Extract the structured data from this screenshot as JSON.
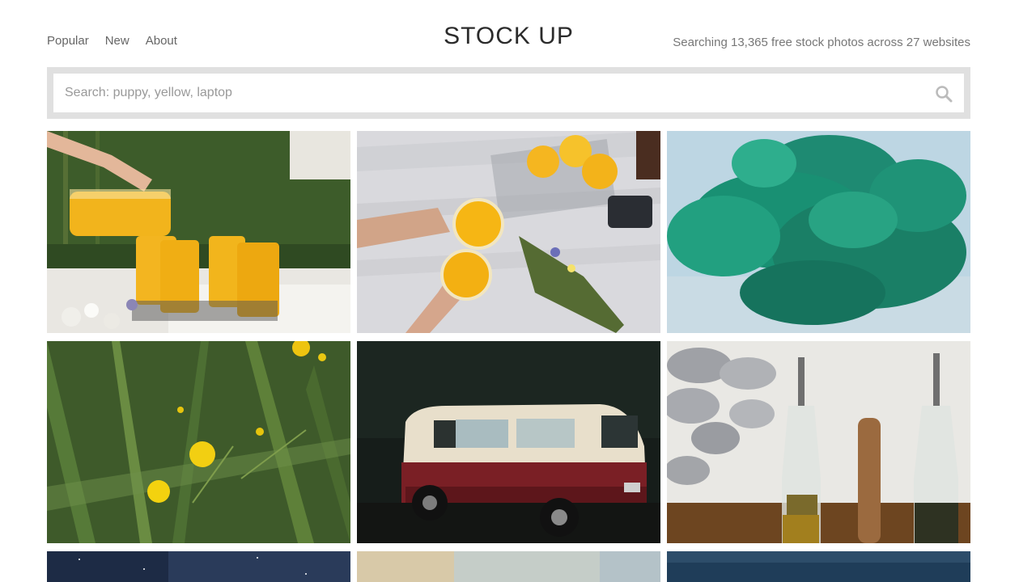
{
  "nav": {
    "items": [
      {
        "label": "Popular"
      },
      {
        "label": "New"
      },
      {
        "label": "About"
      }
    ]
  },
  "logo": "STOCK UP",
  "tagline": "Searching 13,365 free stock photos across 27 websites",
  "search": {
    "placeholder": "Search: puppy, yellow, laptop",
    "value": "",
    "icon": "search-icon"
  },
  "photos": [
    {
      "subject": "orange-juice-picnic"
    },
    {
      "subject": "juice-glasses-blanket"
    },
    {
      "subject": "green-smoke"
    },
    {
      "subject": "yellow-wildflowers"
    },
    {
      "subject": "vintage-van"
    },
    {
      "subject": "oil-bottles"
    },
    {
      "subject": "night-sky"
    },
    {
      "subject": "sunset-sky"
    },
    {
      "subject": "blue-dusk"
    }
  ],
  "colors": {
    "logo": "#2b2b2b",
    "search_border": "#e0e0e0"
  }
}
